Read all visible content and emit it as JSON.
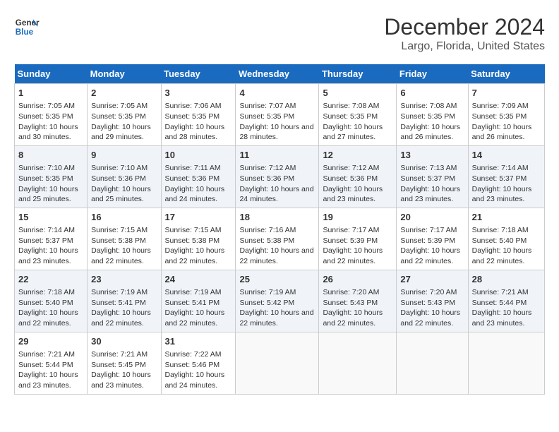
{
  "logo": {
    "line1": "General",
    "line2": "Blue"
  },
  "title": "December 2024",
  "subtitle": "Largo, Florida, United States",
  "days_of_week": [
    "Sunday",
    "Monday",
    "Tuesday",
    "Wednesday",
    "Thursday",
    "Friday",
    "Saturday"
  ],
  "weeks": [
    [
      {
        "num": "1",
        "info": "Sunrise: 7:05 AM\nSunset: 5:35 PM\nDaylight: 10 hours and 30 minutes."
      },
      {
        "num": "2",
        "info": "Sunrise: 7:05 AM\nSunset: 5:35 PM\nDaylight: 10 hours and 29 minutes."
      },
      {
        "num": "3",
        "info": "Sunrise: 7:06 AM\nSunset: 5:35 PM\nDaylight: 10 hours and 28 minutes."
      },
      {
        "num": "4",
        "info": "Sunrise: 7:07 AM\nSunset: 5:35 PM\nDaylight: 10 hours and 28 minutes."
      },
      {
        "num": "5",
        "info": "Sunrise: 7:08 AM\nSunset: 5:35 PM\nDaylight: 10 hours and 27 minutes."
      },
      {
        "num": "6",
        "info": "Sunrise: 7:08 AM\nSunset: 5:35 PM\nDaylight: 10 hours and 26 minutes."
      },
      {
        "num": "7",
        "info": "Sunrise: 7:09 AM\nSunset: 5:35 PM\nDaylight: 10 hours and 26 minutes."
      }
    ],
    [
      {
        "num": "8",
        "info": "Sunrise: 7:10 AM\nSunset: 5:35 PM\nDaylight: 10 hours and 25 minutes."
      },
      {
        "num": "9",
        "info": "Sunrise: 7:10 AM\nSunset: 5:36 PM\nDaylight: 10 hours and 25 minutes."
      },
      {
        "num": "10",
        "info": "Sunrise: 7:11 AM\nSunset: 5:36 PM\nDaylight: 10 hours and 24 minutes."
      },
      {
        "num": "11",
        "info": "Sunrise: 7:12 AM\nSunset: 5:36 PM\nDaylight: 10 hours and 24 minutes."
      },
      {
        "num": "12",
        "info": "Sunrise: 7:12 AM\nSunset: 5:36 PM\nDaylight: 10 hours and 23 minutes."
      },
      {
        "num": "13",
        "info": "Sunrise: 7:13 AM\nSunset: 5:37 PM\nDaylight: 10 hours and 23 minutes."
      },
      {
        "num": "14",
        "info": "Sunrise: 7:14 AM\nSunset: 5:37 PM\nDaylight: 10 hours and 23 minutes."
      }
    ],
    [
      {
        "num": "15",
        "info": "Sunrise: 7:14 AM\nSunset: 5:37 PM\nDaylight: 10 hours and 23 minutes."
      },
      {
        "num": "16",
        "info": "Sunrise: 7:15 AM\nSunset: 5:38 PM\nDaylight: 10 hours and 22 minutes."
      },
      {
        "num": "17",
        "info": "Sunrise: 7:15 AM\nSunset: 5:38 PM\nDaylight: 10 hours and 22 minutes."
      },
      {
        "num": "18",
        "info": "Sunrise: 7:16 AM\nSunset: 5:38 PM\nDaylight: 10 hours and 22 minutes."
      },
      {
        "num": "19",
        "info": "Sunrise: 7:17 AM\nSunset: 5:39 PM\nDaylight: 10 hours and 22 minutes."
      },
      {
        "num": "20",
        "info": "Sunrise: 7:17 AM\nSunset: 5:39 PM\nDaylight: 10 hours and 22 minutes."
      },
      {
        "num": "21",
        "info": "Sunrise: 7:18 AM\nSunset: 5:40 PM\nDaylight: 10 hours and 22 minutes."
      }
    ],
    [
      {
        "num": "22",
        "info": "Sunrise: 7:18 AM\nSunset: 5:40 PM\nDaylight: 10 hours and 22 minutes."
      },
      {
        "num": "23",
        "info": "Sunrise: 7:19 AM\nSunset: 5:41 PM\nDaylight: 10 hours and 22 minutes."
      },
      {
        "num": "24",
        "info": "Sunrise: 7:19 AM\nSunset: 5:41 PM\nDaylight: 10 hours and 22 minutes."
      },
      {
        "num": "25",
        "info": "Sunrise: 7:19 AM\nSunset: 5:42 PM\nDaylight: 10 hours and 22 minutes."
      },
      {
        "num": "26",
        "info": "Sunrise: 7:20 AM\nSunset: 5:43 PM\nDaylight: 10 hours and 22 minutes."
      },
      {
        "num": "27",
        "info": "Sunrise: 7:20 AM\nSunset: 5:43 PM\nDaylight: 10 hours and 22 minutes."
      },
      {
        "num": "28",
        "info": "Sunrise: 7:21 AM\nSunset: 5:44 PM\nDaylight: 10 hours and 23 minutes."
      }
    ],
    [
      {
        "num": "29",
        "info": "Sunrise: 7:21 AM\nSunset: 5:44 PM\nDaylight: 10 hours and 23 minutes."
      },
      {
        "num": "30",
        "info": "Sunrise: 7:21 AM\nSunset: 5:45 PM\nDaylight: 10 hours and 23 minutes."
      },
      {
        "num": "31",
        "info": "Sunrise: 7:22 AM\nSunset: 5:46 PM\nDaylight: 10 hours and 24 minutes."
      },
      {
        "num": "",
        "info": ""
      },
      {
        "num": "",
        "info": ""
      },
      {
        "num": "",
        "info": ""
      },
      {
        "num": "",
        "info": ""
      }
    ]
  ]
}
